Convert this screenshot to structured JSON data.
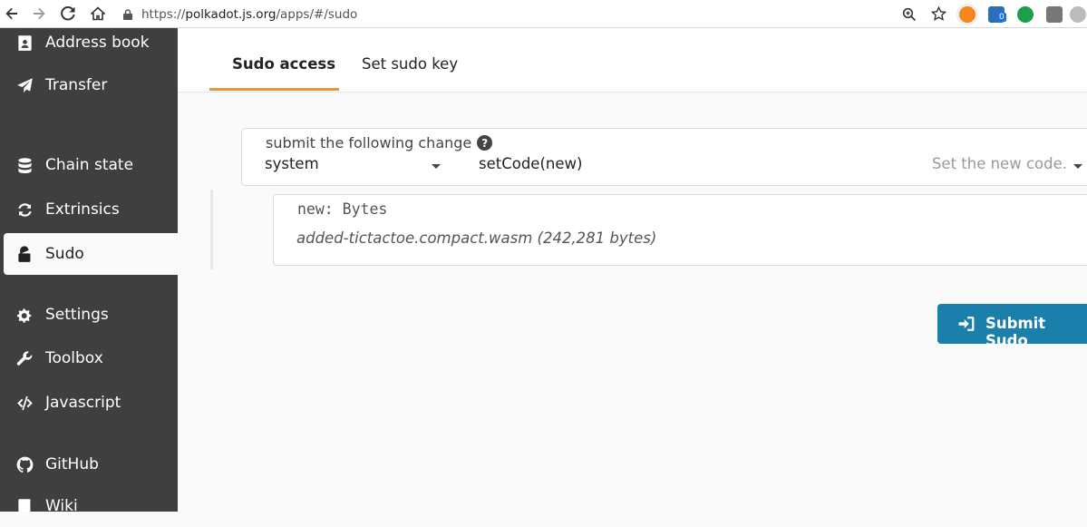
{
  "browser": {
    "url_prefix": "https://",
    "url_domain": "polkadot.js.org",
    "url_path": "/apps/#/sudo",
    "extension_badge": "0"
  },
  "sidebar": {
    "items": [
      {
        "label": "Address book",
        "icon": "address-book-icon"
      },
      {
        "label": "Transfer",
        "icon": "paper-plane-icon"
      },
      {
        "label": "Chain state",
        "icon": "database-icon"
      },
      {
        "label": "Extrinsics",
        "icon": "sync-icon"
      },
      {
        "label": "Sudo",
        "icon": "unlock-icon",
        "active": true
      },
      {
        "label": "Settings",
        "icon": "cogs-icon"
      },
      {
        "label": "Toolbox",
        "icon": "wrench-icon"
      },
      {
        "label": "Javascript",
        "icon": "code-icon"
      },
      {
        "label": "GitHub",
        "icon": "github-icon"
      },
      {
        "label": "Wiki",
        "icon": "book-icon"
      }
    ]
  },
  "tabs": [
    {
      "label": "Sudo access",
      "active": true
    },
    {
      "label": "Set sudo key",
      "active": false
    }
  ],
  "form": {
    "label": "submit the following change",
    "help": "?",
    "module": "system",
    "method": "setCode(new)",
    "method_description": "Set the new code.",
    "param_label": "new: Bytes",
    "param_value": "added-tictactoe.compact.wasm (242,281 bytes)"
  },
  "actions": {
    "submit_label": "Submit Sudo"
  },
  "colors": {
    "sidebar_bg": "#3f3f3f",
    "accent": "#f19135",
    "submit_bg": "#1a7fab"
  }
}
